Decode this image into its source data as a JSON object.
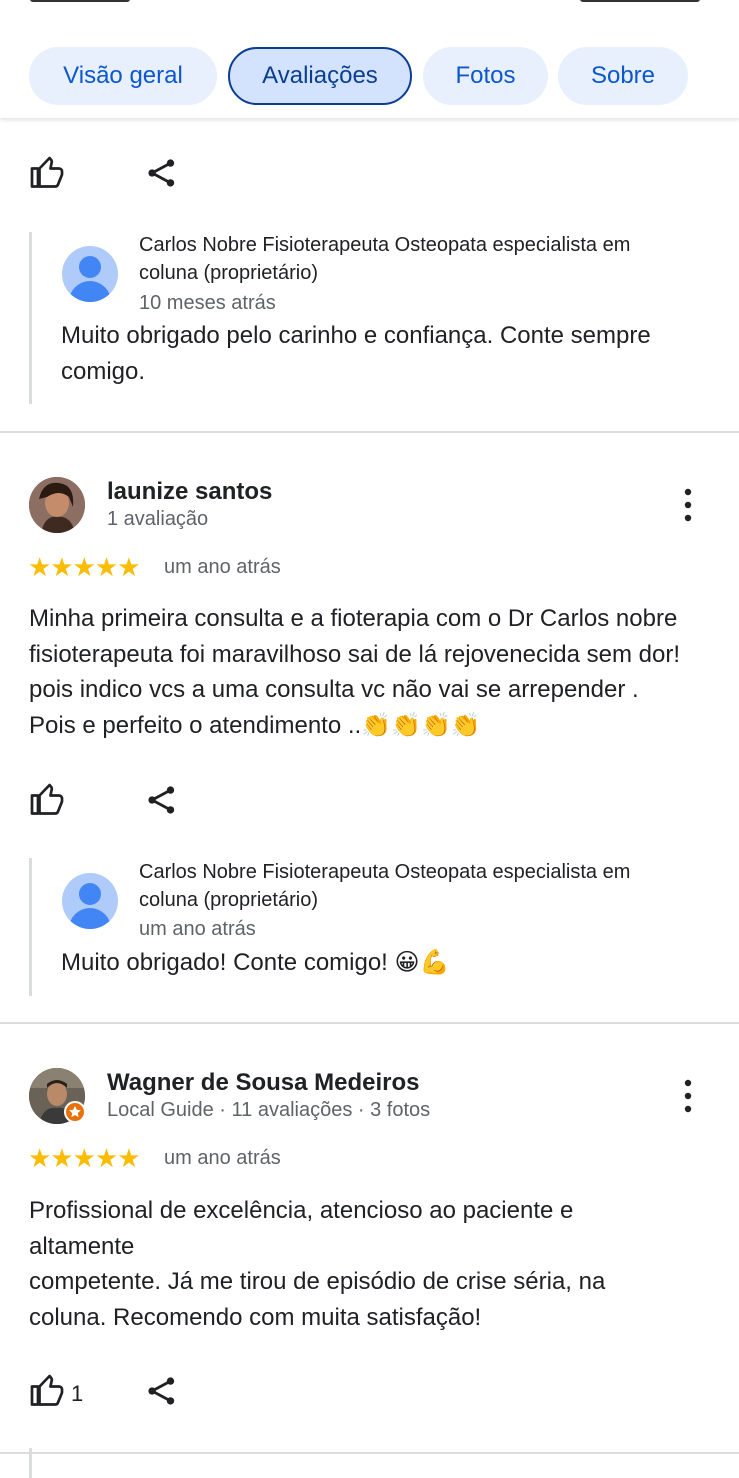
{
  "tabs": [
    {
      "label": "Visão geral"
    },
    {
      "label": "Avaliações"
    },
    {
      "label": "Fotos"
    },
    {
      "label": "Sobre"
    }
  ],
  "colors": {
    "star": "#fbbc04",
    "link": "#0b57d0",
    "tab_bg": "#e8f0fe"
  },
  "icons": {
    "like": "thumbs-up-icon",
    "share": "share-icon",
    "more": "more-vert-icon"
  },
  "review0": {
    "reply": {
      "owner_name_line1": "Carlos Nobre Fisioterapeuta Osteopata especialista em",
      "owner_name_line2": "coluna (proprietário)",
      "time": "10 meses atrás",
      "text_line1": "Muito obrigado pelo carinho e confiança. Conte sempre",
      "text_line2": "comigo."
    }
  },
  "review1": {
    "author": "launize santos",
    "meta": "1 avaliação",
    "stars": "★★★★★",
    "rating": 5,
    "time": "um ano atrás",
    "text_line1": "Minha primeira consulta e a fioterapia com o Dr Carlos nobre",
    "text_line2": "fisioterapeuta foi maravilhoso sai de lá rejovenecida sem dor!",
    "text_line3": "pois indico vcs a uma consulta vc não vai se arrepender .",
    "text_line4": "Pois e perfeito o atendimento ..",
    "emoji": "👏👏👏👏",
    "reply": {
      "owner_name_line1": "Carlos Nobre Fisioterapeuta Osteopata especialista em",
      "owner_name_line2": "coluna (proprietário)",
      "time": "um ano atrás",
      "text": "Muito obrigado! Conte comigo!",
      "emoji": "😀💪"
    }
  },
  "review2": {
    "author": "Wagner de Sousa Medeiros",
    "meta": "Local Guide · 11 avaliações · 3 fotos",
    "stars": "★★★★★",
    "rating": 5,
    "time": "um ano atrás",
    "text_line1": "Profissional de excelência, atencioso ao paciente e",
    "text_line2": "altamente",
    "text_line3": "competente. Já me tirou de episódio de crise séria, na",
    "text_line4": "coluna. Recomendo com muita satisfação!",
    "likes": "1"
  }
}
